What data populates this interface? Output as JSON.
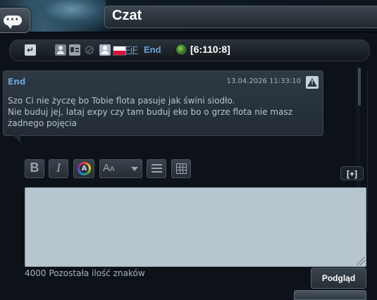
{
  "header": {
    "title": "Czat",
    "chat_icon": "chat-bubble-icon"
  },
  "infobar": {
    "alliance": "FiF",
    "player": "End",
    "coords": "[6:110:8]",
    "icons": [
      "return-icon",
      "user-icon",
      "contact-card-icon",
      "block-icon",
      "user-icon",
      "flag-poland-icon",
      "planet-globe-icon"
    ]
  },
  "message": {
    "author": "End",
    "date": "13.04.2026 11:33:10",
    "report_icon": "warning-icon",
    "lines": [
      "Szo Ci nie życzę bo Tobie flota pasuje jak świni siodło.",
      "Nie buduj jej, lataj expy czy tam buduj eko bo o grze flota nie masz",
      "żadnego pojęcia"
    ]
  },
  "toolbar": {
    "bold": "B",
    "italic": "I",
    "size_label": "A",
    "size_label_small": "A",
    "expand": "[+]"
  },
  "editor": {
    "value": "",
    "placeholder": ""
  },
  "footer": {
    "counter": "4000 Pozostała ilość znaków",
    "preview": "Podgląd"
  },
  "colors": {
    "link": "#6ba3d8",
    "editor_bg": "#b7c5ce",
    "background": "#0c1218"
  }
}
